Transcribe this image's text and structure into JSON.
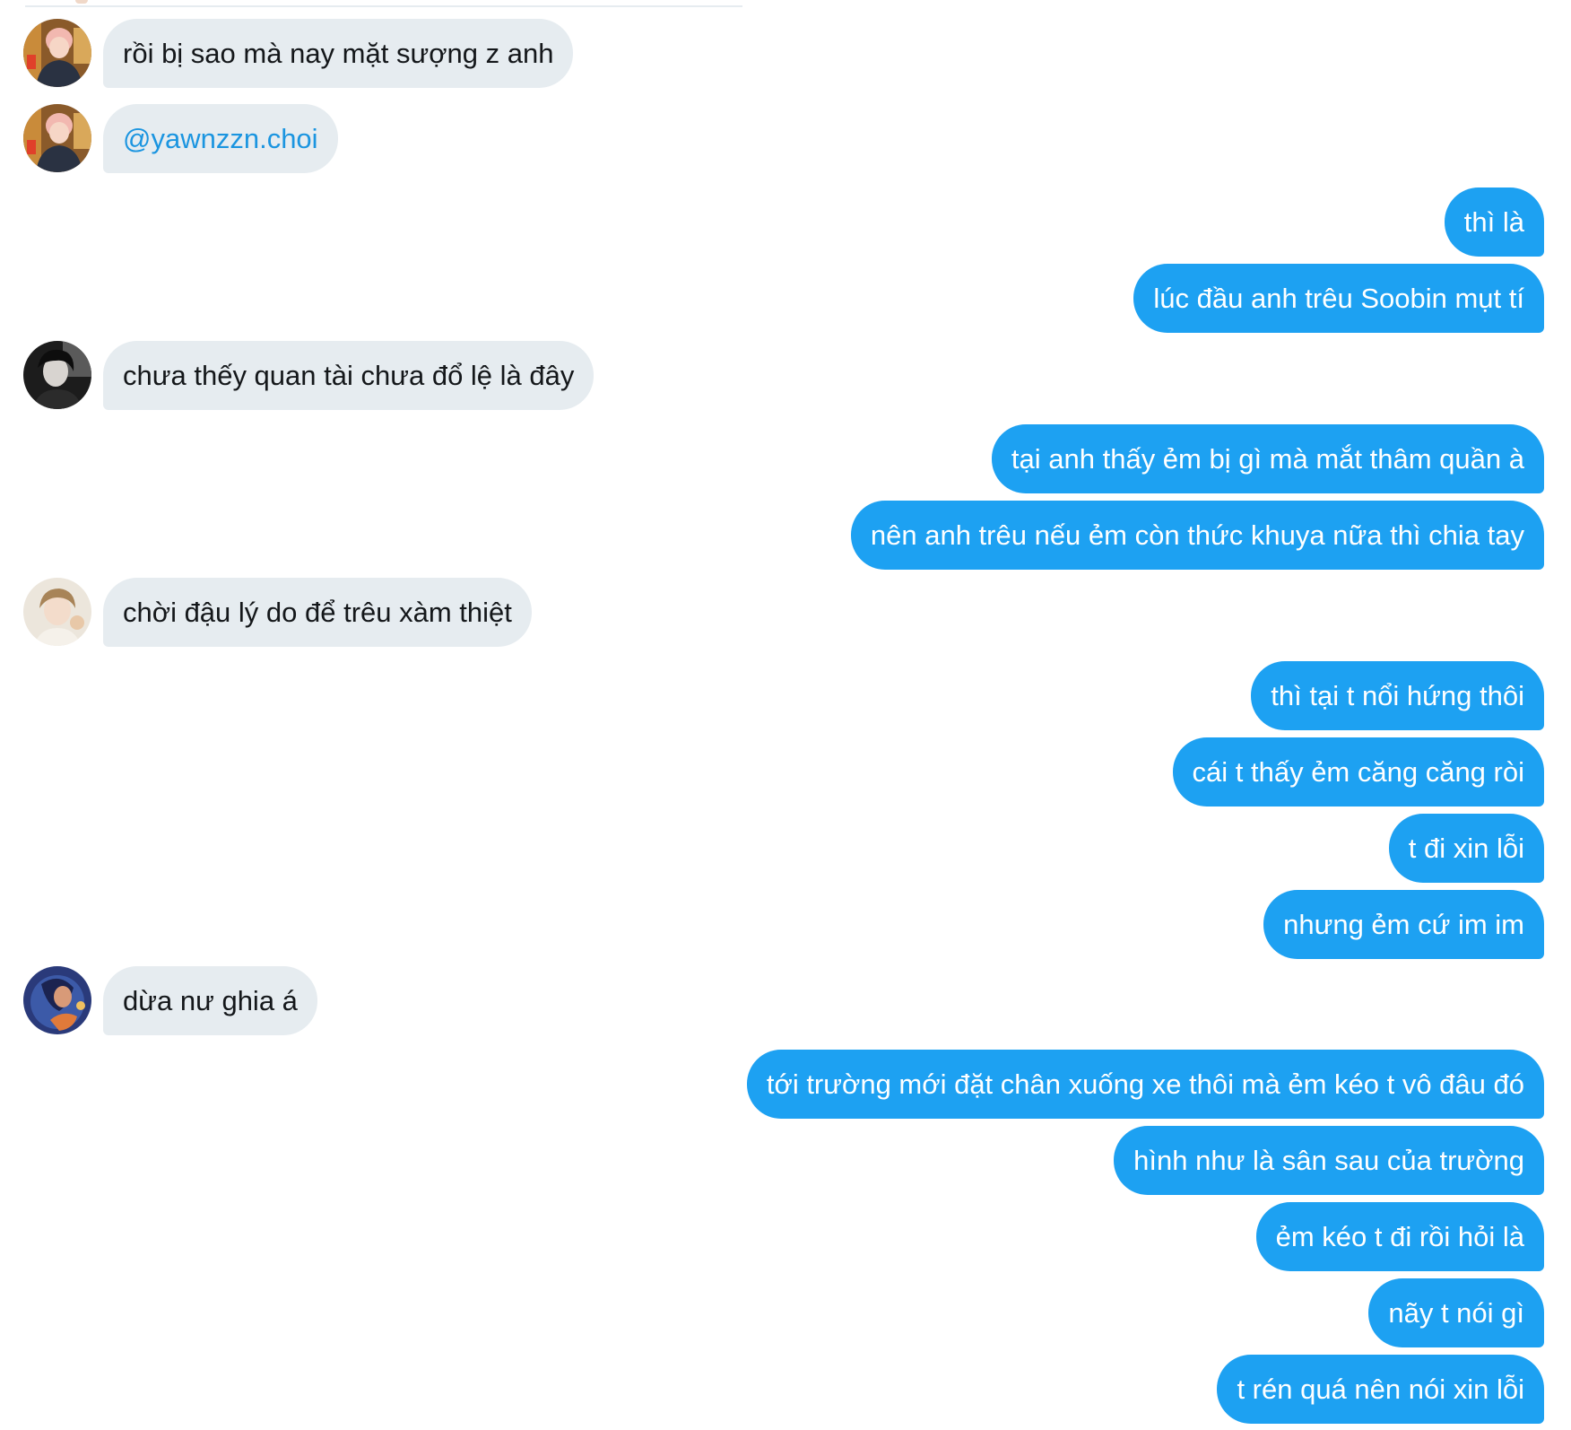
{
  "conversation": {
    "messages": [
      {
        "side": "in",
        "text": "rồi bị sao mà nay mặt sượng z anh",
        "avatar": "pink-hair-avatar"
      },
      {
        "side": "in",
        "text": "@yawnzzn.choi",
        "avatar": "pink-hair-avatar",
        "is_mention": true
      },
      {
        "side": "out",
        "text": "thì là"
      },
      {
        "side": "out",
        "text": "lúc đầu anh trêu Soobin mụt tí"
      },
      {
        "side": "in",
        "text": "chưa thếy quan tài chưa đổ lệ là đây",
        "avatar": "dark-hair-avatar"
      },
      {
        "side": "out",
        "text": "tại anh thấy ẻm bị gì mà mắt thâm quần à"
      },
      {
        "side": "out",
        "text": "nên anh trêu nếu ẻm còn thức khuya nữa thì chia tay"
      },
      {
        "side": "in",
        "text": "chời đậu lý do để trêu xàm thiệt",
        "avatar": "light-hair-avatar"
      },
      {
        "side": "out",
        "text": "thì tại t nổi hứng thôi"
      },
      {
        "side": "out",
        "text": "cái t thấy ẻm căng căng ròi"
      },
      {
        "side": "out",
        "text": "t đi xin lỗi"
      },
      {
        "side": "out",
        "text": "nhưng ẻm cứ im im"
      },
      {
        "side": "in",
        "text": "dừa nư ghia á",
        "avatar": "illustrated-avatar"
      },
      {
        "side": "out",
        "text": "tới trường mới đặt chân xuống xe thôi mà ẻm kéo t vô đâu đó"
      },
      {
        "side": "out",
        "text": "hình như là sân sau của trường"
      },
      {
        "side": "out",
        "text": "ẻm kéo t đi rồi hỏi là"
      },
      {
        "side": "out",
        "text": "nãy t nói gì"
      },
      {
        "side": "out",
        "text": "t rén quá nên nói xin lỗi"
      }
    ]
  },
  "colors": {
    "incoming_bubble": "#e6ecf0",
    "incoming_text": "#14171a",
    "outgoing_bubble": "#1da1f2",
    "outgoing_text": "#ffffff",
    "mention": "#1b95e0"
  }
}
